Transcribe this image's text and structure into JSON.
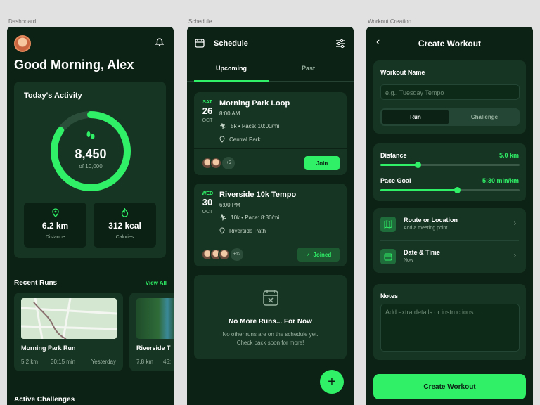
{
  "captions": {
    "dashboard": "Dashboard",
    "schedule": "Schedule",
    "creation": "Workout Creation"
  },
  "dashboard": {
    "greeting": "Good Morning, Alex",
    "activity_title": "Today's Activity",
    "steps": "8,450",
    "steps_goal": "of 10,000",
    "steps_progress": 0.845,
    "distance_value": "6.2 km",
    "distance_label": "Distance",
    "calories_value": "312 kcal",
    "calories_label": "Calories",
    "recent_runs_title": "Recent Runs",
    "view_all": "View All",
    "runs": [
      {
        "name": "Morning Park Run",
        "distance": "5.2 km",
        "duration": "30:15 min",
        "when": "Yesterday"
      },
      {
        "name": "Riverside T",
        "distance": "7.8 km",
        "duration": "45:"
      }
    ],
    "challenges_title": "Active Challenges",
    "colors": {
      "accent": "#2ff067",
      "bg": "#0c2214",
      "card": "#173523"
    }
  },
  "schedule": {
    "title": "Schedule",
    "tabs": [
      {
        "label": "Upcoming"
      },
      {
        "label": "Past"
      }
    ],
    "events": [
      {
        "day": "SAT",
        "date": "26",
        "month": "OCT",
        "title": "Morning Park Loop",
        "time": "8:00 AM",
        "details": "5k • Pace: 10:00/mi",
        "location": "Central Park",
        "more": "+5",
        "action": "Join"
      },
      {
        "day": "WED",
        "date": "30",
        "month": "OCT",
        "title": "Riverside 10k Tempo",
        "time": "6:00 PM",
        "details": "10k • Pace: 8:30/mi",
        "location": "Riverside Path",
        "more": "+12",
        "action": "Joined"
      }
    ],
    "empty_title": "No More Runs... For Now",
    "empty_text_1": "No other runs are on the schedule yet.",
    "empty_text_2": "Check back soon for more!"
  },
  "create": {
    "title": "Create Workout",
    "name_label": "Workout Name",
    "name_placeholder": "e.g., Tuesday Tempo",
    "type_run": "Run",
    "type_challenge": "Challenge",
    "distance_label": "Distance",
    "distance_value": "5.0 km",
    "distance_level": 0.27,
    "pace_label": "Pace Goal",
    "pace_value": "5:30 min/km",
    "pace_level": 0.55,
    "route_title": "Route or Location",
    "route_sub": "Add a meeting point",
    "date_title": "Date & Time",
    "date_sub": "Now",
    "notes_label": "Notes",
    "notes_placeholder": "Add extra details or instructions...",
    "submit": "Create Workout"
  }
}
